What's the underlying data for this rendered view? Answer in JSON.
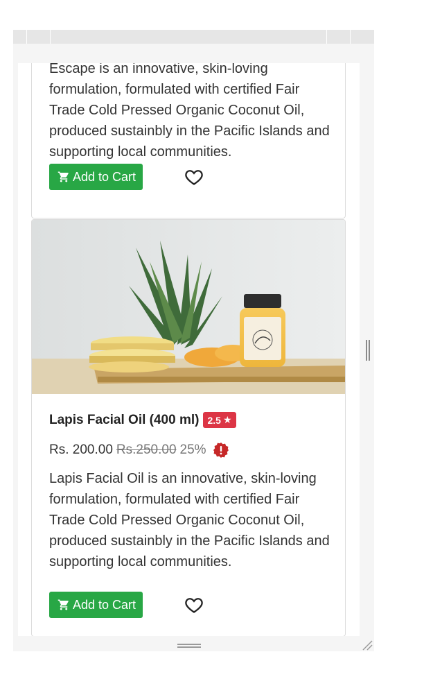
{
  "products": [
    {
      "description": "Escape is an innovative, skin-loving formulation, formulated with certified Fair Trade Cold Pressed Organic Coconut Oil, produced sustainbly in the Pacific Islands and supporting local communities.",
      "add_to_cart_label": "Add to Cart"
    },
    {
      "name": "Lapis Facial Oil (400 ml)",
      "rating": "2.5",
      "rating_star": "★",
      "price": "Rs. 200.00",
      "old_price": "Rs.250.00",
      "discount": "25%",
      "description": "Lapis Facial Oil is an innovative, skin-loving formulation, formulated with certified Fair Trade Cold Pressed Organic Coconut Oil, produced sustainbly in the Pacific Islands and supporting local communities.",
      "add_to_cart_label": "Add to Cart"
    }
  ],
  "icons": {
    "cart": "cart-icon",
    "heart": "heart-icon",
    "alert": "alert-badge-icon"
  },
  "colors": {
    "cart_button": "#28a745",
    "rating_badge": "#dc3545",
    "alert_badge": "#c62828"
  }
}
